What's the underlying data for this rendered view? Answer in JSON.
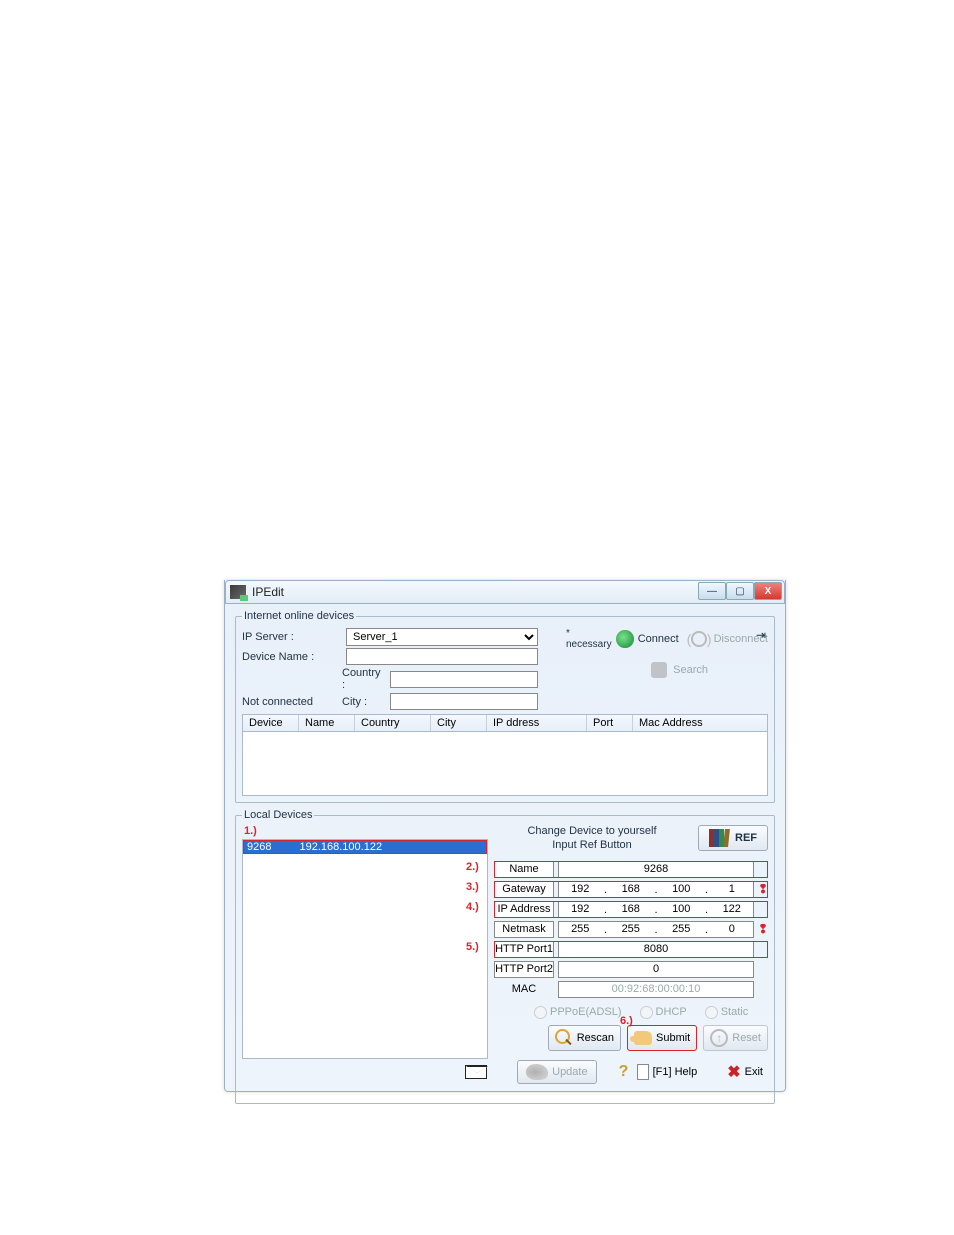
{
  "window": {
    "title": "IPEdit"
  },
  "winctrls": {
    "min": "—",
    "max": "▢",
    "close": "X"
  },
  "online": {
    "legend": "Internet online devices",
    "ipserver_label": "IP Server :",
    "ipserver_value": "Server_1",
    "devname_label": "Device Name :",
    "devname_value": "",
    "country_label": "Country :",
    "country_value": "",
    "city_label": "City :",
    "city_value": "",
    "notconn": "Not connected",
    "necessary": "* necessary",
    "connect": "Connect",
    "disconnect": "Disconnect",
    "search": "Search",
    "cols": {
      "device": "Device",
      "name": "Name",
      "country": "Country",
      "city": "City",
      "ip": "IP ddress",
      "port": "Port",
      "mac": "Mac Address"
    }
  },
  "local": {
    "legend": "Local Devices",
    "sel_name": "9268",
    "sel_ip": "192.168.100.122",
    "hint1": "Change Device to yourself",
    "hint2": "Input Ref Button",
    "ref": "REF",
    "labels": {
      "name": "Name",
      "gateway": "Gateway",
      "ip": "IP Address",
      "netmask": "Netmask",
      "port1": "HTTP Port1",
      "port2": "HTTP Port2",
      "mac": "MAC"
    },
    "name_val": "9268",
    "gateway": [
      "192",
      "168",
      "100",
      "1"
    ],
    "ip": [
      "192",
      "168",
      "100",
      "122"
    ],
    "netmask": [
      "255",
      "255",
      "255",
      "0"
    ],
    "port1": "8080",
    "port2": "0",
    "mac": "00:92:68:00:00:10",
    "radios": {
      "pppoe": "PPPoE(ADSL)",
      "dhcp": "DHCP",
      "static": "Static"
    },
    "btns": {
      "rescan": "Rescan",
      "submit": "Submit",
      "reset": "Reset"
    },
    "annot": {
      "n1": "1.)",
      "n2": "2.)",
      "n3": "3.)",
      "n4": "4.)",
      "n5": "5.)",
      "n6": "6.)"
    }
  },
  "bottom": {
    "update": "Update",
    "help": "[F1] Help",
    "exit": "Exit"
  }
}
